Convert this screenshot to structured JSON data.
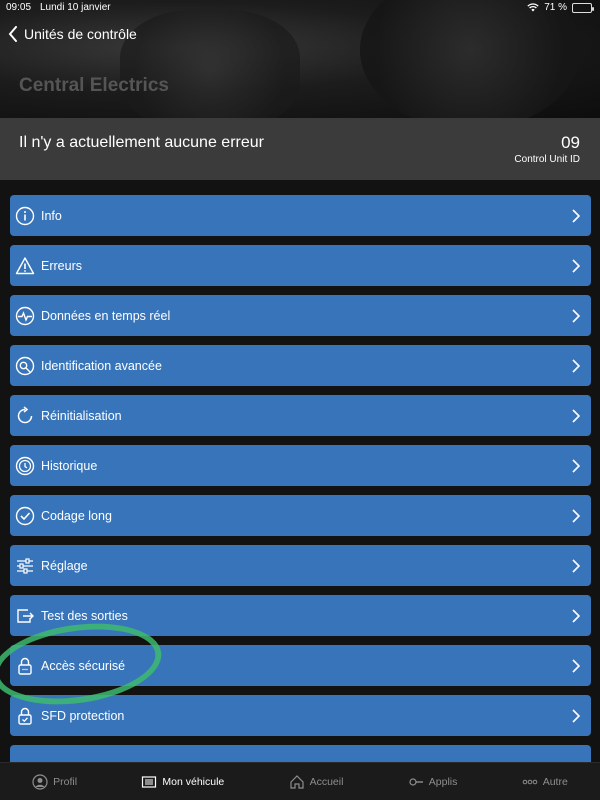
{
  "status_bar": {
    "time": "09:05",
    "date": "Lundi 10 janvier",
    "battery": "71 %",
    "battery_level": 0.71
  },
  "nav": {
    "back_label": "Unités de contrôle"
  },
  "hero": {
    "title": "Central Electrics"
  },
  "banner": {
    "message": "Il n'y a actuellement aucune erreur",
    "unit_id": "09",
    "unit_id_label": "Control Unit ID"
  },
  "items": [
    {
      "label": "Info",
      "icon": "info-icon"
    },
    {
      "label": "Erreurs",
      "icon": "warning-icon"
    },
    {
      "label": "Données en temps réel",
      "icon": "pulse-icon"
    },
    {
      "label": "Identification avancée",
      "icon": "identification-icon"
    },
    {
      "label": "Réinitialisation",
      "icon": "reset-icon"
    },
    {
      "label": "Historique",
      "icon": "history-icon"
    },
    {
      "label": "Codage long",
      "icon": "coding-icon"
    },
    {
      "label": "Réglage",
      "icon": "sliders-icon"
    },
    {
      "label": "Test des sorties",
      "icon": "output-test-icon"
    },
    {
      "label": "Accès sécurisé",
      "icon": "lock-icon"
    },
    {
      "label": "SFD protection",
      "icon": "sfd-lock-icon"
    },
    {
      "label": "",
      "icon": ""
    }
  ],
  "tabs": [
    {
      "label": "Profil",
      "icon": "profile-icon",
      "active": false
    },
    {
      "label": "Mon véhicule",
      "icon": "vehicle-icon",
      "active": true
    },
    {
      "label": "Accueil",
      "icon": "home-icon",
      "active": false
    },
    {
      "label": "Applis",
      "icon": "apps-icon",
      "active": false
    },
    {
      "label": "Autre",
      "icon": "more-icon",
      "active": false
    }
  ],
  "colors": {
    "item_bg": "#3874b9",
    "banner_bg": "#3b3b3b",
    "highlight": "#3dba6f",
    "battery": "#4cd964"
  }
}
